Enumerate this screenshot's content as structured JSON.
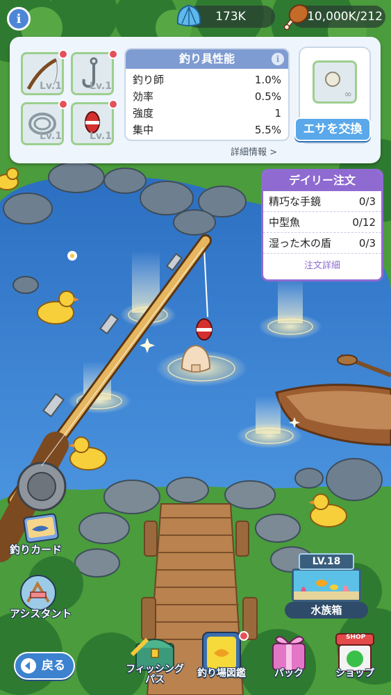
{
  "header": {
    "info_icon": "info-icon",
    "shells": "173K",
    "food": "10,000K/212",
    "shell_icon": "shell-icon",
    "food_icon": "drumstick-icon"
  },
  "gear": {
    "slots": [
      {
        "name": "fishing-rod-icon",
        "level": "Lv.1"
      },
      {
        "name": "fishing-hook-icon",
        "level": "Lv.1"
      },
      {
        "name": "fishing-line-icon",
        "level": "Lv.1"
      },
      {
        "name": "float-bobber-icon",
        "level": "Lv.1"
      }
    ],
    "title": "釣り具性能",
    "stats": [
      {
        "label": "釣り師",
        "value": "1.0%"
      },
      {
        "label": "効率",
        "value": "0.5%"
      },
      {
        "label": "強度",
        "value": "1"
      },
      {
        "label": "集中",
        "value": "5.5%"
      }
    ],
    "detail_link": "詳細情報 >",
    "bait_icon": "pearl-bait-icon",
    "bait_count": "∞",
    "bait_button": "エサを交換"
  },
  "daily_order": {
    "title": "デイリー注文",
    "items": [
      {
        "name": "精巧な手鏡",
        "progress": "0/3"
      },
      {
        "name": "中型魚",
        "progress": "0/12"
      },
      {
        "name": "湿った木の盾",
        "progress": "0/3"
      }
    ],
    "detail": "注文詳細"
  },
  "side_buttons": {
    "fishing_card": "釣りカード",
    "assistant": "アシスタント"
  },
  "aquarium": {
    "level": "LV.18",
    "label": "水族箱"
  },
  "bottom": {
    "back": "戻る",
    "fishing_pass": "フィッシング\nパス",
    "fishing_pass_line1": "フィッシング",
    "fishing_pass_line2": "パス",
    "encyclopedia": "釣り場図鑑",
    "pack": "パック",
    "shop": "ショップ",
    "shop_sign": "SHOP"
  },
  "colors": {
    "water": "#3b7fd0",
    "grass": "#4a9c3c",
    "accent_purple": "#8e6ad1",
    "accent_blue": "#5aa8ea"
  }
}
